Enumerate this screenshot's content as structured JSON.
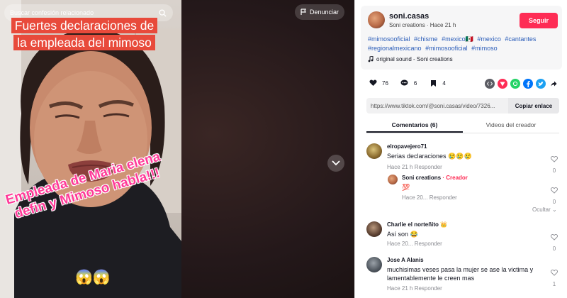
{
  "video": {
    "search_placeholder": "Buscar confesión relacionado",
    "caption_top": "Fuertes declaraciones de la empleada del mimoso",
    "caption_bottom": "Empleada de Maria elena defin y Mimoso habla!!!",
    "caption_emoji": "😱😱",
    "report_label": "Denunciar"
  },
  "post": {
    "username": "soni.casas",
    "subline": "Soni creations · Hace 21 h",
    "follow_label": "Seguir",
    "hashtags": [
      "#mimosooficial",
      "#chisme",
      "#mexico🇲🇽",
      "#mexico",
      "#cantantes",
      "#regionalmexicano",
      "#mimosooficial",
      "#mimoso"
    ],
    "music": "original sound - Soni creations",
    "likes": "76",
    "comments": "6",
    "saves": "4",
    "link": "https://www.tiktok.com/@soni.casas/video/7326...",
    "copy_label": "Copiar enlace"
  },
  "tabs": [
    "Comentarios (6)",
    "Videos del creador"
  ],
  "comments": [
    {
      "name": "elropavejero71",
      "text": "Serias declaraciones 😢😢😢",
      "meta": "Hace 21 h   Responder",
      "likes": "0"
    },
    {
      "name": "Soni creations",
      "tag": " · Creador",
      "text": "💯",
      "meta": "Hace 20...   Responder",
      "likes": "0"
    },
    {
      "name": "Charlie el norteñito 👑",
      "text": "Así son 😂",
      "meta": "Hace 20...   Responder",
      "likes": "0"
    },
    {
      "name": "Jose A Alanis",
      "text": "muchisimas veses pasa la mujer se ase la victima y lamentablemente le creen mas",
      "meta": "Hace 21 h   Responder",
      "likes": "1"
    }
  ],
  "hide_label": "Ocultar ⌄",
  "colors": {
    "accent": "#fe2c55",
    "hashtag": "#2b5db9",
    "caption_bg": "#e84a3b",
    "caption_pink": "#ff3a98"
  }
}
